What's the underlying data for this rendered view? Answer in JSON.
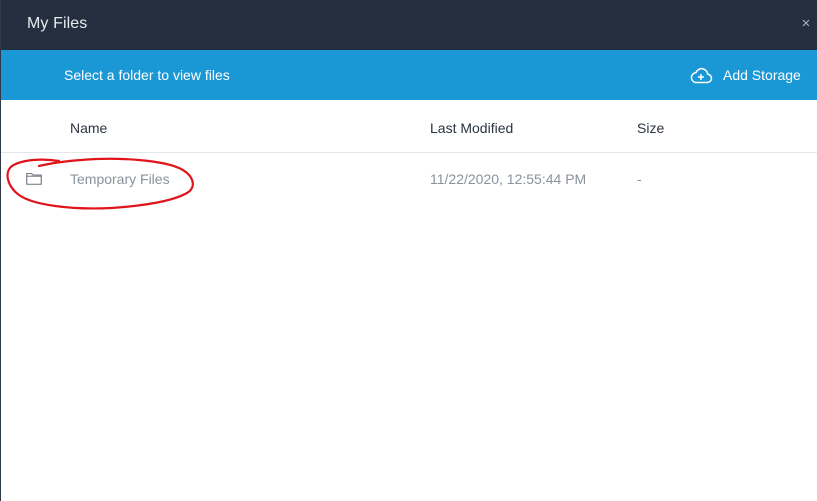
{
  "window": {
    "title": "My Files",
    "close_glyph": "×"
  },
  "toolbar": {
    "instruction": "Select a folder to view files",
    "add_storage_label": "Add Storage",
    "add_storage_icon": "cloud-plus-icon",
    "accent_color": "#1a98d5",
    "titlebar_color": "#232f3e"
  },
  "table": {
    "columns": [
      "Name",
      "Last Modified",
      "Size"
    ],
    "rows": [
      {
        "icon": "folder-icon",
        "name": "Temporary Files",
        "last_modified": "11/22/2020, 12:55:44 PM",
        "size": "-"
      }
    ]
  },
  "annotation": {
    "type": "hand-drawn-circle",
    "color": "#e0141b",
    "target": "Temporary Files"
  }
}
